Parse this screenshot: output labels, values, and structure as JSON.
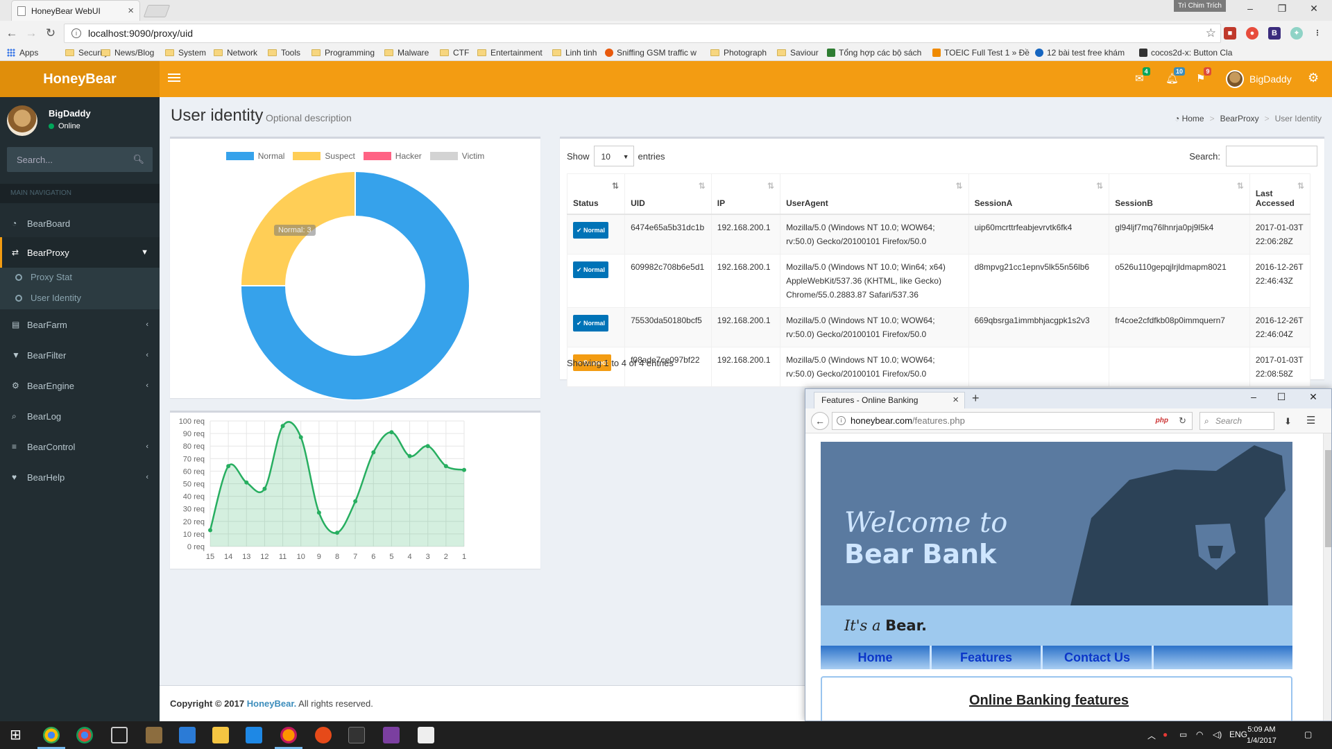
{
  "browser": {
    "tab_title": "HoneyBear WebUI",
    "profile_name": "Trì Chim Trích",
    "url": "localhost:9090/proxy/uid",
    "bookmarks": [
      "Apps",
      "Security",
      "News/Blog",
      "System",
      "Network",
      "Tools",
      "Programming",
      "Malware",
      "CTF",
      "Entertainment",
      "Linh tinh",
      "Sniffing GSM traffic w",
      "Photograph",
      "Saviour",
      "Tổng hợp các bộ sách",
      "TOEIC Full Test 1 » Đề",
      "12 bài test free khám",
      "cocos2d-x: Button Cla"
    ]
  },
  "app": {
    "logo": "HoneyBear",
    "user": "BigDaddy",
    "status": "Online",
    "badges": {
      "mail": "4",
      "bell": "10",
      "flag": "9"
    },
    "colors": {
      "header": "#f39c12",
      "sidebar": "#222d32"
    }
  },
  "sidebar": {
    "search_placeholder": "Search...",
    "section": "MAIN NAVIGATION",
    "items": [
      {
        "label": "BearBoard",
        "icon": "dashboard-icon"
      },
      {
        "label": "BearProxy",
        "icon": "exchange-icon"
      },
      {
        "label": "BearFarm",
        "icon": "server-icon"
      },
      {
        "label": "BearFilter",
        "icon": "filter-icon"
      },
      {
        "label": "BearEngine",
        "icon": "cogs-icon"
      },
      {
        "label": "BearLog",
        "icon": "search-icon"
      },
      {
        "label": "BearControl",
        "icon": "sliders-icon"
      },
      {
        "label": "BearHelp",
        "icon": "heartbeat-icon"
      }
    ],
    "subitems": [
      "Proxy Stat",
      "User Identity"
    ]
  },
  "page": {
    "title": "User identity",
    "description": "Optional description",
    "breadcrumb": [
      "Home",
      "BearProxy",
      "User Identity"
    ]
  },
  "donut_tooltip": "Normal: 3",
  "chart_data": [
    {
      "type": "pie",
      "title": "",
      "categories": [
        "Normal",
        "Suspect",
        "Hacker",
        "Victim"
      ],
      "values": [
        3,
        1,
        0,
        0
      ],
      "colors": [
        "#36a2eb",
        "#ffce56",
        "#ff6384",
        "#d3d3d3"
      ],
      "legend": "top"
    },
    {
      "type": "area",
      "title": "",
      "categories": [
        "15",
        "14",
        "13",
        "12",
        "11",
        "10",
        "9",
        "8",
        "7",
        "6",
        "5",
        "4",
        "3",
        "2",
        "1"
      ],
      "series": [
        {
          "values": [
            13,
            64,
            51,
            46,
            96,
            87,
            27,
            11,
            36,
            75,
            91,
            72,
            80,
            64,
            61
          ]
        }
      ],
      "ylim": [
        0,
        100
      ],
      "yticks": [
        "0 req",
        "10 req",
        "20 req",
        "30 req",
        "40 req",
        "50 req",
        "60 req",
        "70 req",
        "80 req",
        "90 req",
        "100 req"
      ],
      "grid": true,
      "color": "#27ae60"
    }
  ],
  "table": {
    "show_label": "Show",
    "entries_label": "entries",
    "page_size": "10",
    "search_label": "Search:",
    "headers": [
      "Status",
      "UID",
      "IP",
      "UserAgent",
      "SessionA",
      "SessionB",
      "Last Accessed"
    ],
    "rows": [
      {
        "status": "Normal",
        "status_color": "#0073b7",
        "uid": "6474e65a5b31dc1b",
        "ip": "192.168.200.1",
        "ua": "Mozilla/5.0 (Windows NT 10.0; WOW64; rv:50.0) Gecko/20100101 Firefox/50.0",
        "sa": "uip60mcrttrfeabjevrvtk6fk4",
        "sb": "gl94ljf7mq76lhnrja0pj9l5k4",
        "last": "2017-01-03T22:06:28Z"
      },
      {
        "status": "Normal",
        "status_color": "#0073b7",
        "uid": "609982c708b6e5d1",
        "ip": "192.168.200.1",
        "ua": "Mozilla/5.0 (Windows NT 10.0; Win64; x64) AppleWebKit/537.36 (KHTML, like Gecko) Chrome/55.0.2883.87 Safari/537.36",
        "sa": "d8mpvg21cc1epnv5lk55n56lb6",
        "sb": "o526u110gepqjlrjldmapm8021",
        "last": "2016-12-26T22:46:43Z"
      },
      {
        "status": "Normal",
        "status_color": "#0073b7",
        "uid": "75530da50180bcf5",
        "ip": "192.168.200.1",
        "ua": "Mozilla/5.0 (Windows NT 10.0; WOW64; rv:50.0) Gecko/20100101 Firefox/50.0",
        "sa": "669qbsrga1immbhjacgpk1s2v3",
        "sb": "fr4coe2cfdfkb08p0immquern7",
        "last": "2016-12-26T22:46:04Z"
      },
      {
        "status": "Suspect",
        "status_color": "#f39c12",
        "uid": "f08ade7ce097bf22",
        "ip": "192.168.200.1",
        "ua": "Mozilla/5.0 (Windows NT 10.0; WOW64; rv:50.0) Gecko/20100101 Firefox/50.0",
        "sa": "",
        "sb": "",
        "last": "2017-01-03T22:08:58Z"
      }
    ],
    "info": "Showing 1 to 4 of 4 entries"
  },
  "footer": {
    "prefix": "Copyright © 2017",
    "brand": "HoneyBear.",
    "suffix": " All rights reserved."
  },
  "firefox": {
    "tab_title": "Features - Online Banking",
    "url_host": "honeybear.com",
    "url_path": "/features.php",
    "php_badge": "php",
    "search_placeholder": "Search",
    "welcome": "Welcome to",
    "bank": "Bear Bank",
    "tagline_a": "It's a ",
    "tagline_b": "Bear.",
    "nav": [
      "Home",
      "Features",
      "Contact Us"
    ],
    "section_title": "Online Banking features"
  },
  "taskbar": {
    "lang": "ENG",
    "time": "5:09 AM",
    "date": "1/4/2017"
  }
}
